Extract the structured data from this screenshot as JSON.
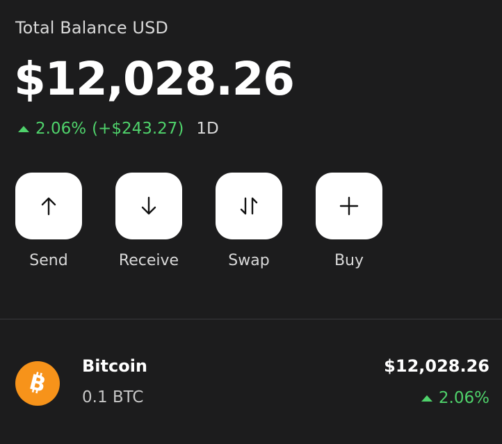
{
  "balance": {
    "label": "Total Balance USD",
    "amount": "$12,028.26",
    "change_percent": "2.06%",
    "change_amount": "(+$243.27)",
    "period": "1D",
    "trend_icon": "triangle-up-icon"
  },
  "actions": [
    {
      "label": "Send",
      "icon": "arrow-up-icon"
    },
    {
      "label": "Receive",
      "icon": "arrow-down-icon"
    },
    {
      "label": "Swap",
      "icon": "swap-arrows-icon"
    },
    {
      "label": "Buy",
      "icon": "plus-icon"
    }
  ],
  "assets": [
    {
      "name": "Bitcoin",
      "amount": "0.1 BTC",
      "value": "$12,028.26",
      "change": "2.06%",
      "icon": "bitcoin-icon"
    }
  ],
  "colors": {
    "background": "#1c1c1d",
    "positive": "#4fd26b",
    "bitcoin": "#f7931a",
    "button": "#ffffff"
  }
}
